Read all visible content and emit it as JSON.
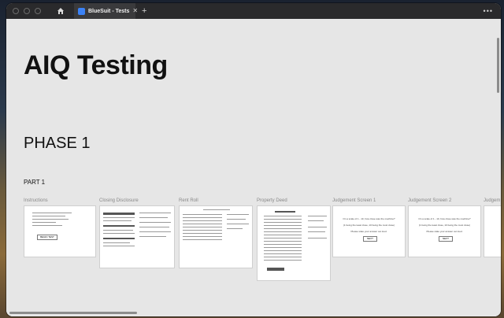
{
  "browser": {
    "tab_title": "BlueSuit - Tests",
    "close_glyph": "✕",
    "new_tab_glyph": "+",
    "more_glyph": "•••"
  },
  "page": {
    "title": "AIQ Testing",
    "phase": "PHASE 1",
    "part": "PART 1",
    "cards": [
      {
        "label": "Instructions",
        "button": "BEGIN TEST"
      },
      {
        "label": "Closing Disclosure"
      },
      {
        "label": "Rent Roll"
      },
      {
        "label": "Property Deed"
      },
      {
        "label": "Judgement Screen 1",
        "question": "On a scale of 1 - 10, how close was the machine?",
        "hint": "(1 being the least close, 10 being the most close)",
        "note": "Please state your answer out loud.",
        "button": "NEXT"
      },
      {
        "label": "Judgement Screen 2",
        "question": "On a scale of 1 - 10, how close was the machine?",
        "hint": "(1 being the least close, 10 being the most close)",
        "note": "Please state your answer out loud.",
        "button": "NEXT"
      },
      {
        "label": "Judgem"
      }
    ]
  },
  "icons": [
    "home-icon",
    "tab-favicon-icon",
    "close-icon",
    "plus-icon",
    "more-icon"
  ],
  "colors": {
    "titlebar": "#2a2a2c",
    "page_bg": "#e6e6e6",
    "favicon": "#3b82f6"
  }
}
